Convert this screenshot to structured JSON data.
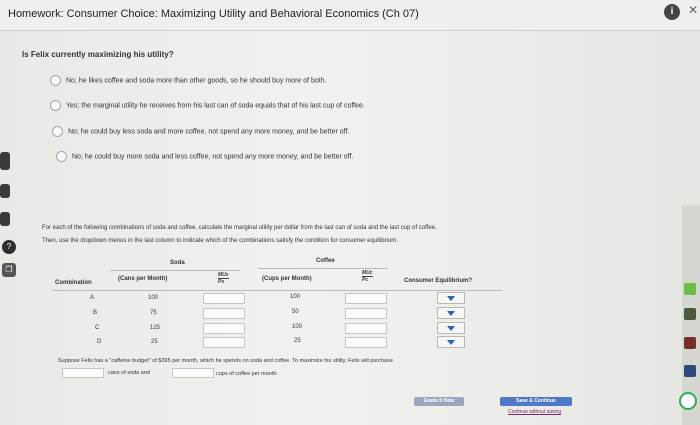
{
  "header": {
    "title": "Homework: Consumer Choice: Maximizing Utility and Behavioral Economics (Ch 07)",
    "info_icon": "info-icon",
    "close_icon": "close-icon"
  },
  "question": {
    "text": "Is Felix currently maximizing his utility?",
    "options": [
      "No; he likes coffee and soda more than other goods, so he should buy more of both.",
      "Yes; the marginal utility he receives from his last can of soda equals that of his last cup of coffee.",
      "No; he could buy less soda and more coffee, not spend any more money, and be better off.",
      "No; he could buy more soda and less coffee, not spend any more money, and be better off."
    ]
  },
  "instructions": {
    "line1": "For each of the following combinations of soda and coffee, calculate the marginal utility per dollar from the last can of soda and the last cup of coffee.",
    "line2": "Then, use the dropdown menus in the last column to indicate which of the combinations satisfy the condition for consumer equilibrium."
  },
  "table": {
    "soda_header": "Soda",
    "coffee_header": "Coffee",
    "combination_header": "Combination",
    "soda_sub": "(Cans per Month)",
    "mu_s_num": "MUs",
    "mu_s_den": "Ps",
    "coffee_sub": "(Cups per Month)",
    "mu_c_num": "MUc",
    "mu_c_den": "Pc",
    "equilibrium_header": "Consumer Equilibrium?",
    "rows": [
      {
        "combo": "A",
        "soda": "100",
        "coffee": "100"
      },
      {
        "combo": "B",
        "soda": "75",
        "coffee": "50"
      },
      {
        "combo": "C",
        "soda": "125",
        "coffee": "100"
      },
      {
        "combo": "D",
        "soda": "25",
        "coffee": "25"
      }
    ]
  },
  "footer": {
    "sentence": "Suppose Felix has a \"caffeine budget\" of $395 per month, which he spends on soda and coffee. To maximize his utility, Felix will purchase",
    "soda_part": "cans of soda and",
    "coffee_part": "cups of coffee per month."
  },
  "buttons": {
    "grade": "Grade It Now",
    "save": "Save & Continue",
    "continue_link": "Continue without saving"
  }
}
